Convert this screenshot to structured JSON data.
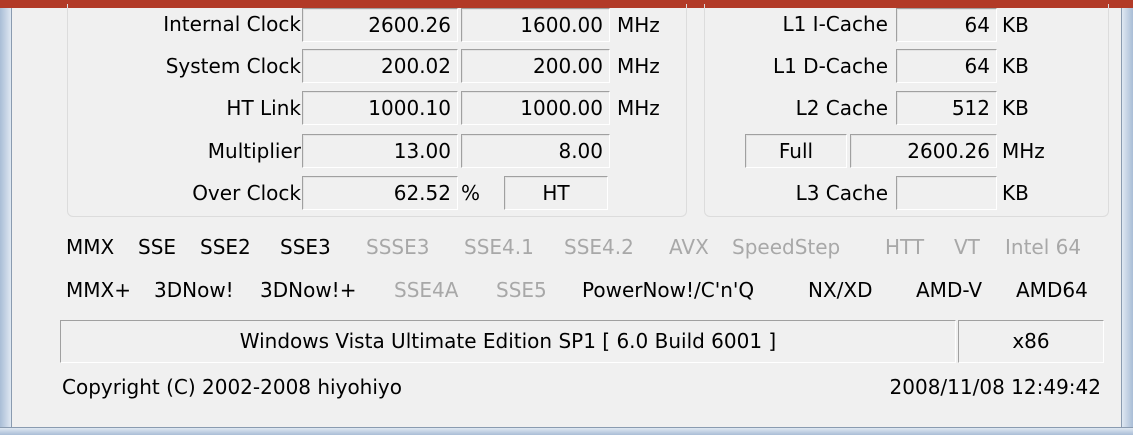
{
  "clock": {
    "rows": [
      {
        "label": "Internal Clock",
        "current": "2600.26",
        "original": "1600.00",
        "unit": "MHz"
      },
      {
        "label": "System Clock",
        "current": "200.02",
        "original": "200.00",
        "unit": "MHz"
      },
      {
        "label": "HT Link",
        "current": "1000.10",
        "original": "1000.00",
        "unit": "MHz"
      },
      {
        "label": "Multiplier",
        "current": "13.00",
        "original": "8.00",
        "unit": ""
      },
      {
        "label": "Over Clock",
        "current": "62.52",
        "pct": "%",
        "original": "HT",
        "unit": ""
      }
    ]
  },
  "cache": {
    "l1i": {
      "label": "L1 I-Cache",
      "value": "64",
      "unit": "KB"
    },
    "l1d": {
      "label": "L1 D-Cache",
      "value": "64",
      "unit": "KB"
    },
    "l2": {
      "label": "L2 Cache",
      "value": "512",
      "unit": "KB"
    },
    "l2speed": {
      "mode": "Full",
      "value": "2600.26",
      "unit": "MHz"
    },
    "l3": {
      "label": "L3 Cache",
      "value": "",
      "unit": "KB"
    }
  },
  "flags_row1": [
    {
      "text": "MMX",
      "on": true
    },
    {
      "text": "SSE",
      "on": true
    },
    {
      "text": "SSE2",
      "on": true
    },
    {
      "text": "SSE3",
      "on": true
    },
    {
      "text": "SSSE3",
      "on": false
    },
    {
      "text": "SSE4.1",
      "on": false
    },
    {
      "text": "SSE4.2",
      "on": false
    },
    {
      "text": "AVX",
      "on": false
    },
    {
      "text": "SpeedStep",
      "on": false
    },
    {
      "text": "HTT",
      "on": false
    },
    {
      "text": "VT",
      "on": false
    },
    {
      "text": "Intel 64",
      "on": false
    }
  ],
  "flags_row2": [
    {
      "text": "MMX+",
      "on": true
    },
    {
      "text": "3DNow!",
      "on": true
    },
    {
      "text": "3DNow!+",
      "on": true
    },
    {
      "text": "SSE4A",
      "on": false
    },
    {
      "text": "SSE5",
      "on": false
    },
    {
      "text": "PowerNow!/C'n'Q",
      "on": true
    },
    {
      "text": "NX/XD",
      "on": true
    },
    {
      "text": "AMD-V",
      "on": true
    },
    {
      "text": "AMD64",
      "on": true
    }
  ],
  "os": {
    "name": "Windows Vista Ultimate Edition SP1 [ 6.0 Build 6001 ]",
    "arch": "x86"
  },
  "footer": {
    "copyright": "Copyright (C) 2002-2008 hiyohiyo",
    "datetime": "2008/11/08 12:49:42"
  },
  "colors": {
    "flag_on": "#000000",
    "flag_off": "#a8a8a8",
    "title_bar": "#b23a27"
  }
}
